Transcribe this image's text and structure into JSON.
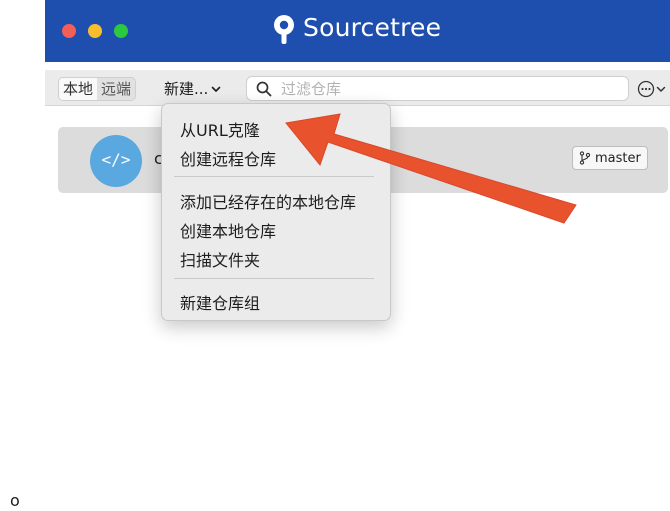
{
  "window": {
    "title": "Sourcetree"
  },
  "toolbar": {
    "local_tab": "本地",
    "remote_tab": "远端",
    "new_menu": "新建...",
    "search_placeholder": "过滤仓库"
  },
  "repo": {
    "name_visible": "c",
    "branch": "master"
  },
  "dropdown": {
    "items": [
      "从URL克隆",
      "创建远程仓库",
      "添加已经存在的本地仓库",
      "创建本地仓库",
      "扫描文件夹",
      "新建仓库组"
    ]
  },
  "stray_text": "o",
  "icons": {
    "logo": "sourcetree-logo-icon",
    "search": "search-icon",
    "more": "ellipsis-circle-icon",
    "branch": "branch-icon",
    "repo": "code-icon",
    "annotation": "red-arrow-annotation"
  },
  "colors": {
    "titlebar": "#1e4fae",
    "arrow": "#e8532e",
    "avatar": "#5aa8e0"
  }
}
